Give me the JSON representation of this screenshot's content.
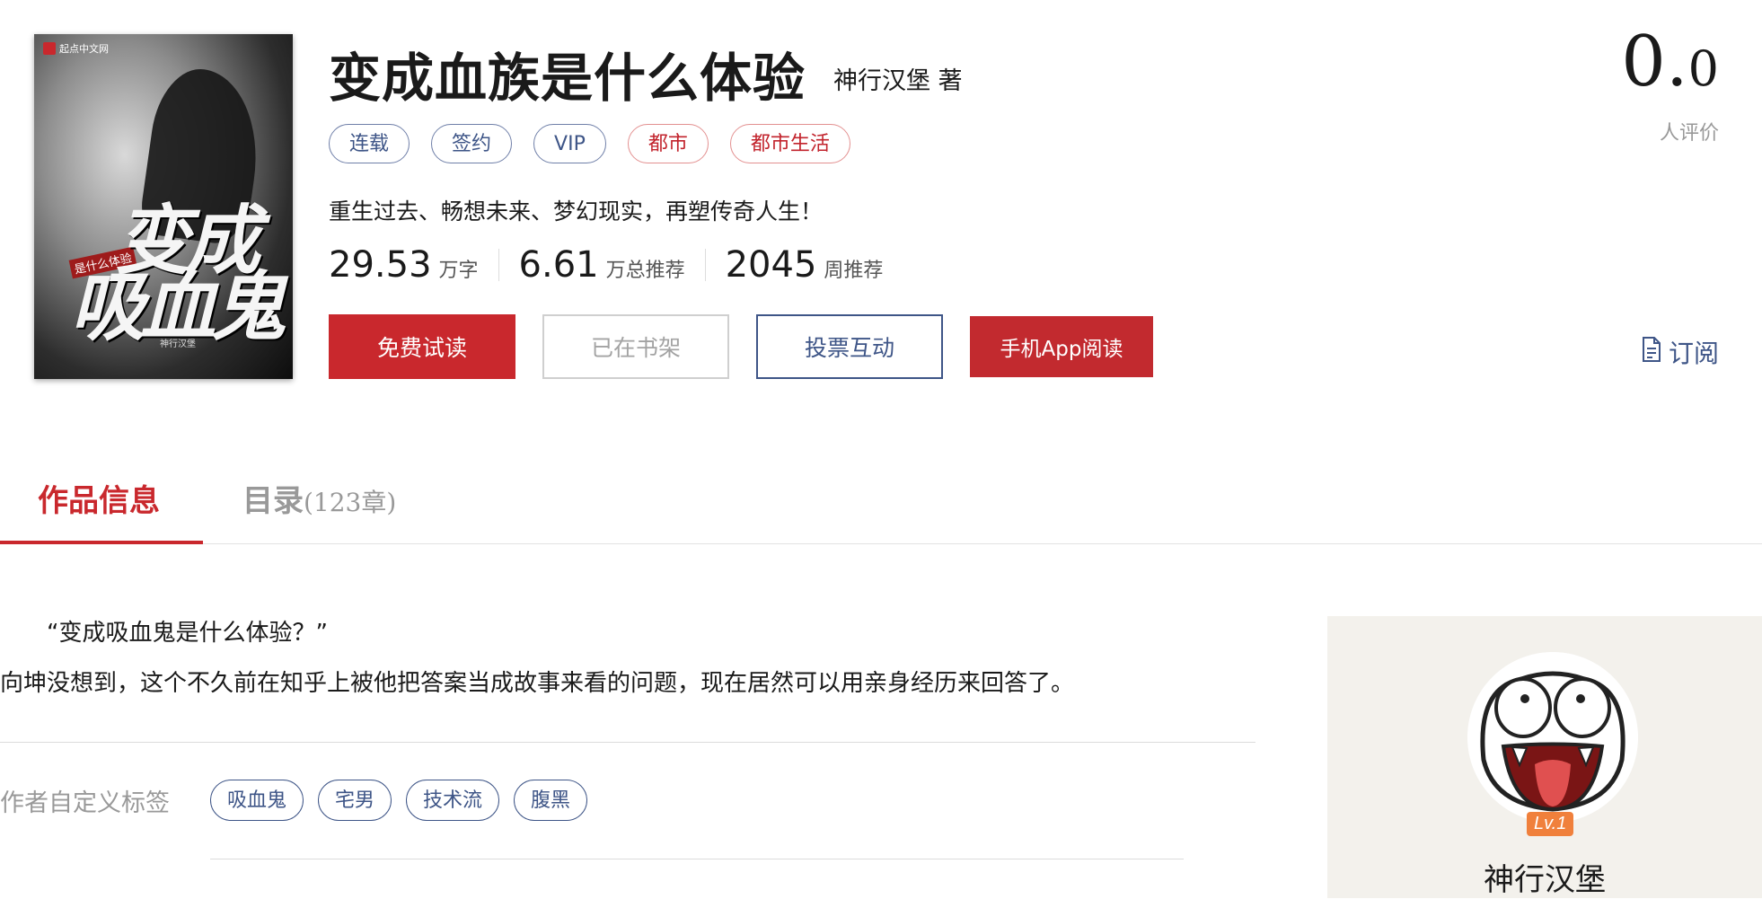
{
  "cover": {
    "logo_text": "起点中文网",
    "title_line1": "变成",
    "title_line2": "吸血鬼",
    "subtitle": "是什么体验",
    "author": "神行汉堡"
  },
  "book": {
    "title": "变成血族是什么体验",
    "author": "神行汉堡 著",
    "tags": [
      {
        "label": "连载",
        "style": "blue"
      },
      {
        "label": "签约",
        "style": "blue"
      },
      {
        "label": "VIP",
        "style": "blue"
      },
      {
        "label": "都市",
        "style": "red"
      },
      {
        "label": "都市生活",
        "style": "red"
      }
    ],
    "intro": "重生过去、畅想未来、梦幻现实，再塑传奇人生！",
    "stats": [
      {
        "num": "29.53",
        "unit": "万字"
      },
      {
        "num": "6.61",
        "unit": "万总推荐"
      },
      {
        "num": "2045",
        "unit": "周推荐"
      }
    ]
  },
  "actions": {
    "read": "免费试读",
    "shelf": "已在书架",
    "vote": "投票互动",
    "app": "手机App阅读",
    "subscribe": "订阅"
  },
  "rating": {
    "int": "0.",
    "dec": "0",
    "label": "人评价"
  },
  "tabs": {
    "info": "作品信息",
    "toc": "目录",
    "toc_count": "(123章)"
  },
  "description": {
    "line1": "“变成吸血鬼是什么体验？”",
    "line2": "向坤没想到，这个不久前在知乎上被他把答案当成故事来看的问题，现在居然可以用亲身经历来回答了。"
  },
  "custom_tags": {
    "label": "作者自定义标签",
    "items": [
      "吸血鬼",
      "宅男",
      "技术流",
      "腹黑"
    ]
  },
  "author_panel": {
    "level": "Lv.1",
    "name": "神行汉堡"
  },
  "colors": {
    "accent_red": "#c9282d",
    "accent_blue": "#3e5587",
    "level_orange": "#f0803c"
  }
}
